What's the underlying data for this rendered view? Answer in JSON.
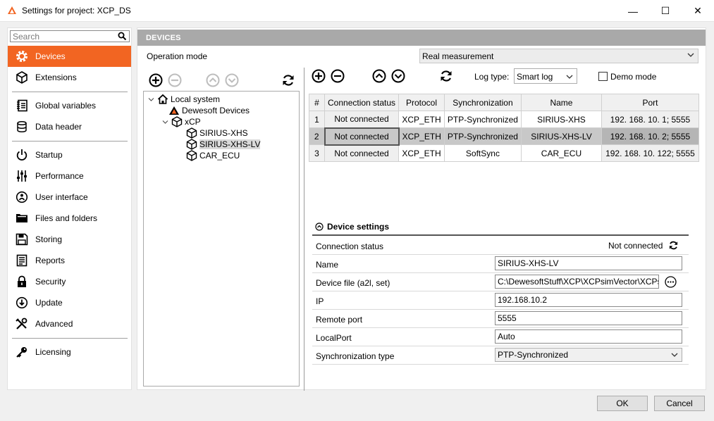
{
  "window": {
    "title": "Settings for project: XCP_DS",
    "minimize_glyph": "—",
    "maximize_glyph": "☐",
    "close_glyph": "✕"
  },
  "colors": {
    "accent": "#f26522",
    "header_gray": "#a9a9a9"
  },
  "search": {
    "placeholder": "Search"
  },
  "nav": {
    "items": [
      {
        "label": "Devices",
        "icon": "gear-icon"
      },
      {
        "label": "Extensions",
        "icon": "cube-icon"
      },
      {
        "label": "Global variables",
        "icon": "notebook-icon"
      },
      {
        "label": "Data header",
        "icon": "database-icon"
      },
      {
        "label": "Startup",
        "icon": "power-icon"
      },
      {
        "label": "Performance",
        "icon": "sliders-icon"
      },
      {
        "label": "User interface",
        "icon": "user-interface-icon"
      },
      {
        "label": "Files and folders",
        "icon": "folders-icon"
      },
      {
        "label": "Storing",
        "icon": "floppy-icon"
      },
      {
        "label": "Reports",
        "icon": "report-icon"
      },
      {
        "label": "Security",
        "icon": "lock-icon"
      },
      {
        "label": "Update",
        "icon": "update-icon"
      },
      {
        "label": "Advanced",
        "icon": "tools-icon"
      },
      {
        "label": "Licensing",
        "icon": "key-icon"
      }
    ]
  },
  "devices": {
    "header": "DEVICES",
    "operation_mode_label": "Operation mode",
    "operation_mode_value": "Real measurement",
    "tree": {
      "root": "Local system",
      "dewesoft": "Dewesoft Devices",
      "xcp": "xCP",
      "children": [
        "SIRIUS-XHS",
        "SIRIUS-XHS-LV",
        "CAR_ECU"
      ]
    },
    "log_type_label": "Log type:",
    "log_type_value": "Smart log",
    "demo_mode_label": "Demo mode",
    "table": {
      "columns": [
        "#",
        "Connection status",
        "Protocol",
        "Synchronization",
        "Name",
        "Port"
      ],
      "rows": [
        [
          "1",
          "Not connected",
          "XCP_ETH",
          "PTP-Synchronized",
          "SIRIUS-XHS",
          "192. 168. 10. 1; 5555"
        ],
        [
          "2",
          "Not connected",
          "XCP_ETH",
          "PTP-Synchronized",
          "SIRIUS-XHS-LV",
          "192. 168. 10. 2; 5555"
        ],
        [
          "3",
          "Not connected",
          "XCP_ETH",
          "SoftSync",
          "CAR_ECU",
          "192. 168. 10. 122; 5555"
        ]
      ]
    },
    "settings": {
      "title": "Device settings",
      "connection_status_label": "Connection status",
      "connection_status_value": "Not connected",
      "name_label": "Name",
      "name_value": "SIRIUS-XHS-LV",
      "device_file_label": "Device file (a2l, set)",
      "device_file_value": "C:\\DewesoftStuff\\XCP\\XCPsimVector\\XCPsim_",
      "ip_label": "IP",
      "ip_value": "192.168.10.2",
      "remote_port_label": "Remote port",
      "remote_port_value": "5555",
      "local_port_label": "LocalPort",
      "local_port_value": "Auto",
      "sync_type_label": "Synchronization type",
      "sync_type_value": "PTP-Synchronized"
    }
  },
  "footer": {
    "ok_label": "OK",
    "cancel_label": "Cancel"
  }
}
